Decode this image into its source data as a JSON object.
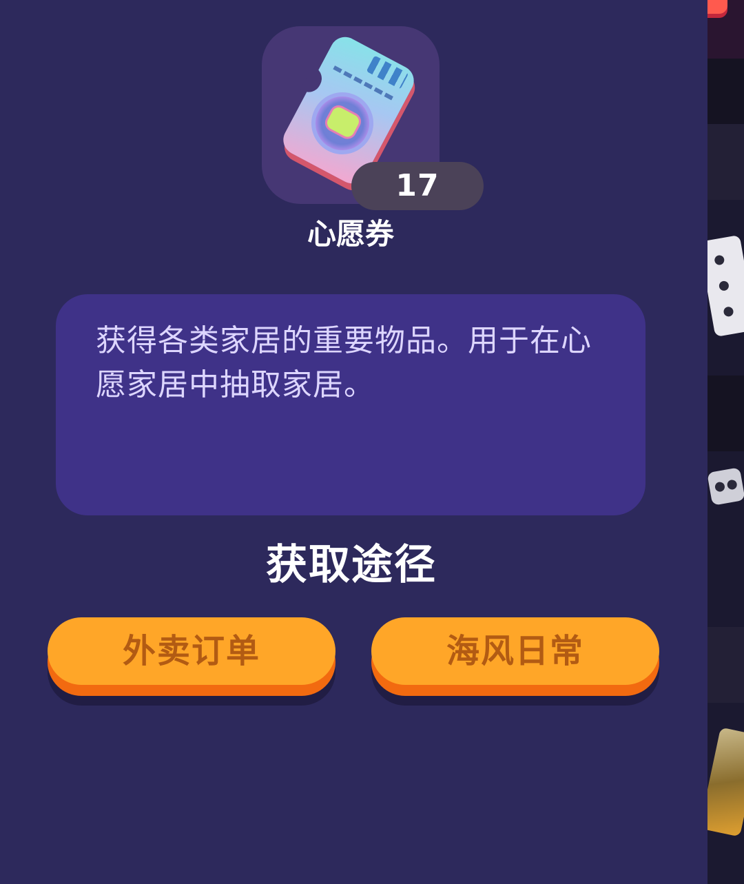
{
  "item": {
    "name": "心愿券",
    "count": "17",
    "description": "获得各类家居的重要物品。用于在心愿家居中抽取家居。",
    "icon": "wish-ticket-icon"
  },
  "sources": {
    "title": "获取途径",
    "buttons": [
      {
        "label": "外卖订单"
      },
      {
        "label": "海风日常"
      }
    ]
  },
  "colors": {
    "panel_bg": "#2d295c",
    "tile_bg": "#463774",
    "desc_bg": "#3f3288",
    "button_orange": "#ffa628",
    "button_shadow": "#f26a10",
    "button_text": "#b25b13"
  }
}
